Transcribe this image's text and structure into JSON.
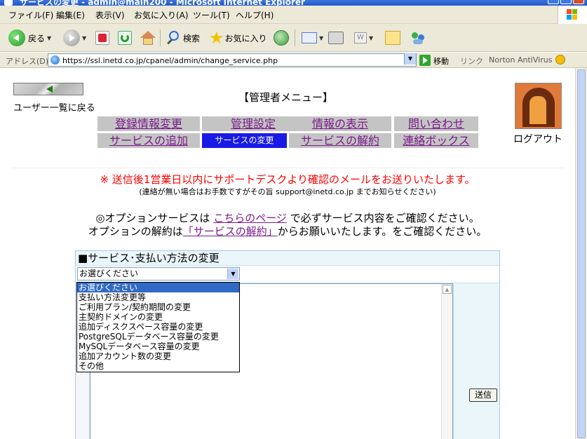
{
  "window": {
    "title": "サービスの変更 - admin@main200 - Microsoft Internet Explorer"
  },
  "menubar": {
    "items": [
      "ファイル(F)",
      "編集(E)",
      "表示(V)",
      "お気に入り(A)",
      "ツール(T)",
      "ヘルプ(H)"
    ]
  },
  "toolbar": {
    "back": "戻る",
    "search": "検索",
    "favorites": "お気に入り"
  },
  "addressbar": {
    "label": "アドレス(D)",
    "url": "https://ssl.inetd.co.jp/cpanel/admin/change_service.php",
    "go": "移動",
    "links": "リンク",
    "norton": "Norton AntiVirus"
  },
  "page": {
    "back_label": "ユーザー一覧に戻る",
    "title": "【管理者メニュー】",
    "logout": "ログアウト",
    "nav": {
      "register": "登録情報変更",
      "admin_settings": "管理設定",
      "info_display": "情報の表示",
      "contact": "問い合わせ",
      "add_service": "サービスの追加",
      "change_service": "サービスの変更",
      "cancel_service": "サービスの解約",
      "mailbox": "連絡ボックス"
    },
    "notice_red": "※ 送信後1営業日以内にサポートデスクより確認のメールをお送りいたします。",
    "notice_small": "(連絡が無い場合はお手数ですがその旨 support@inetd.co.jp までお知らせください)",
    "option_line1_pre": "◎オプションサービスは",
    "option_line1_link": "こちらのページ",
    "option_line1_post": "で必ずサービス内容をご確認ください。",
    "option_line2_pre": "オプションの解約は",
    "option_line2_link": "「サービスの解約」",
    "option_line2_post": "からお願いいたします。をご確認ください。"
  },
  "form": {
    "header": "■サービス･支払い方法の変更",
    "select_value": "お選びください",
    "options": [
      "お選びください",
      "支払い方法変更等",
      "ご利用プラン/契約期間の変更",
      "主契約ドメインの変更",
      "追加ディスクスペース容量の変更",
      "PostgreSQLデータベース容量の変更",
      "MySQLデータベース容量の変更",
      "追加アカウント数の変更",
      "その他"
    ],
    "submit": "送信"
  }
}
